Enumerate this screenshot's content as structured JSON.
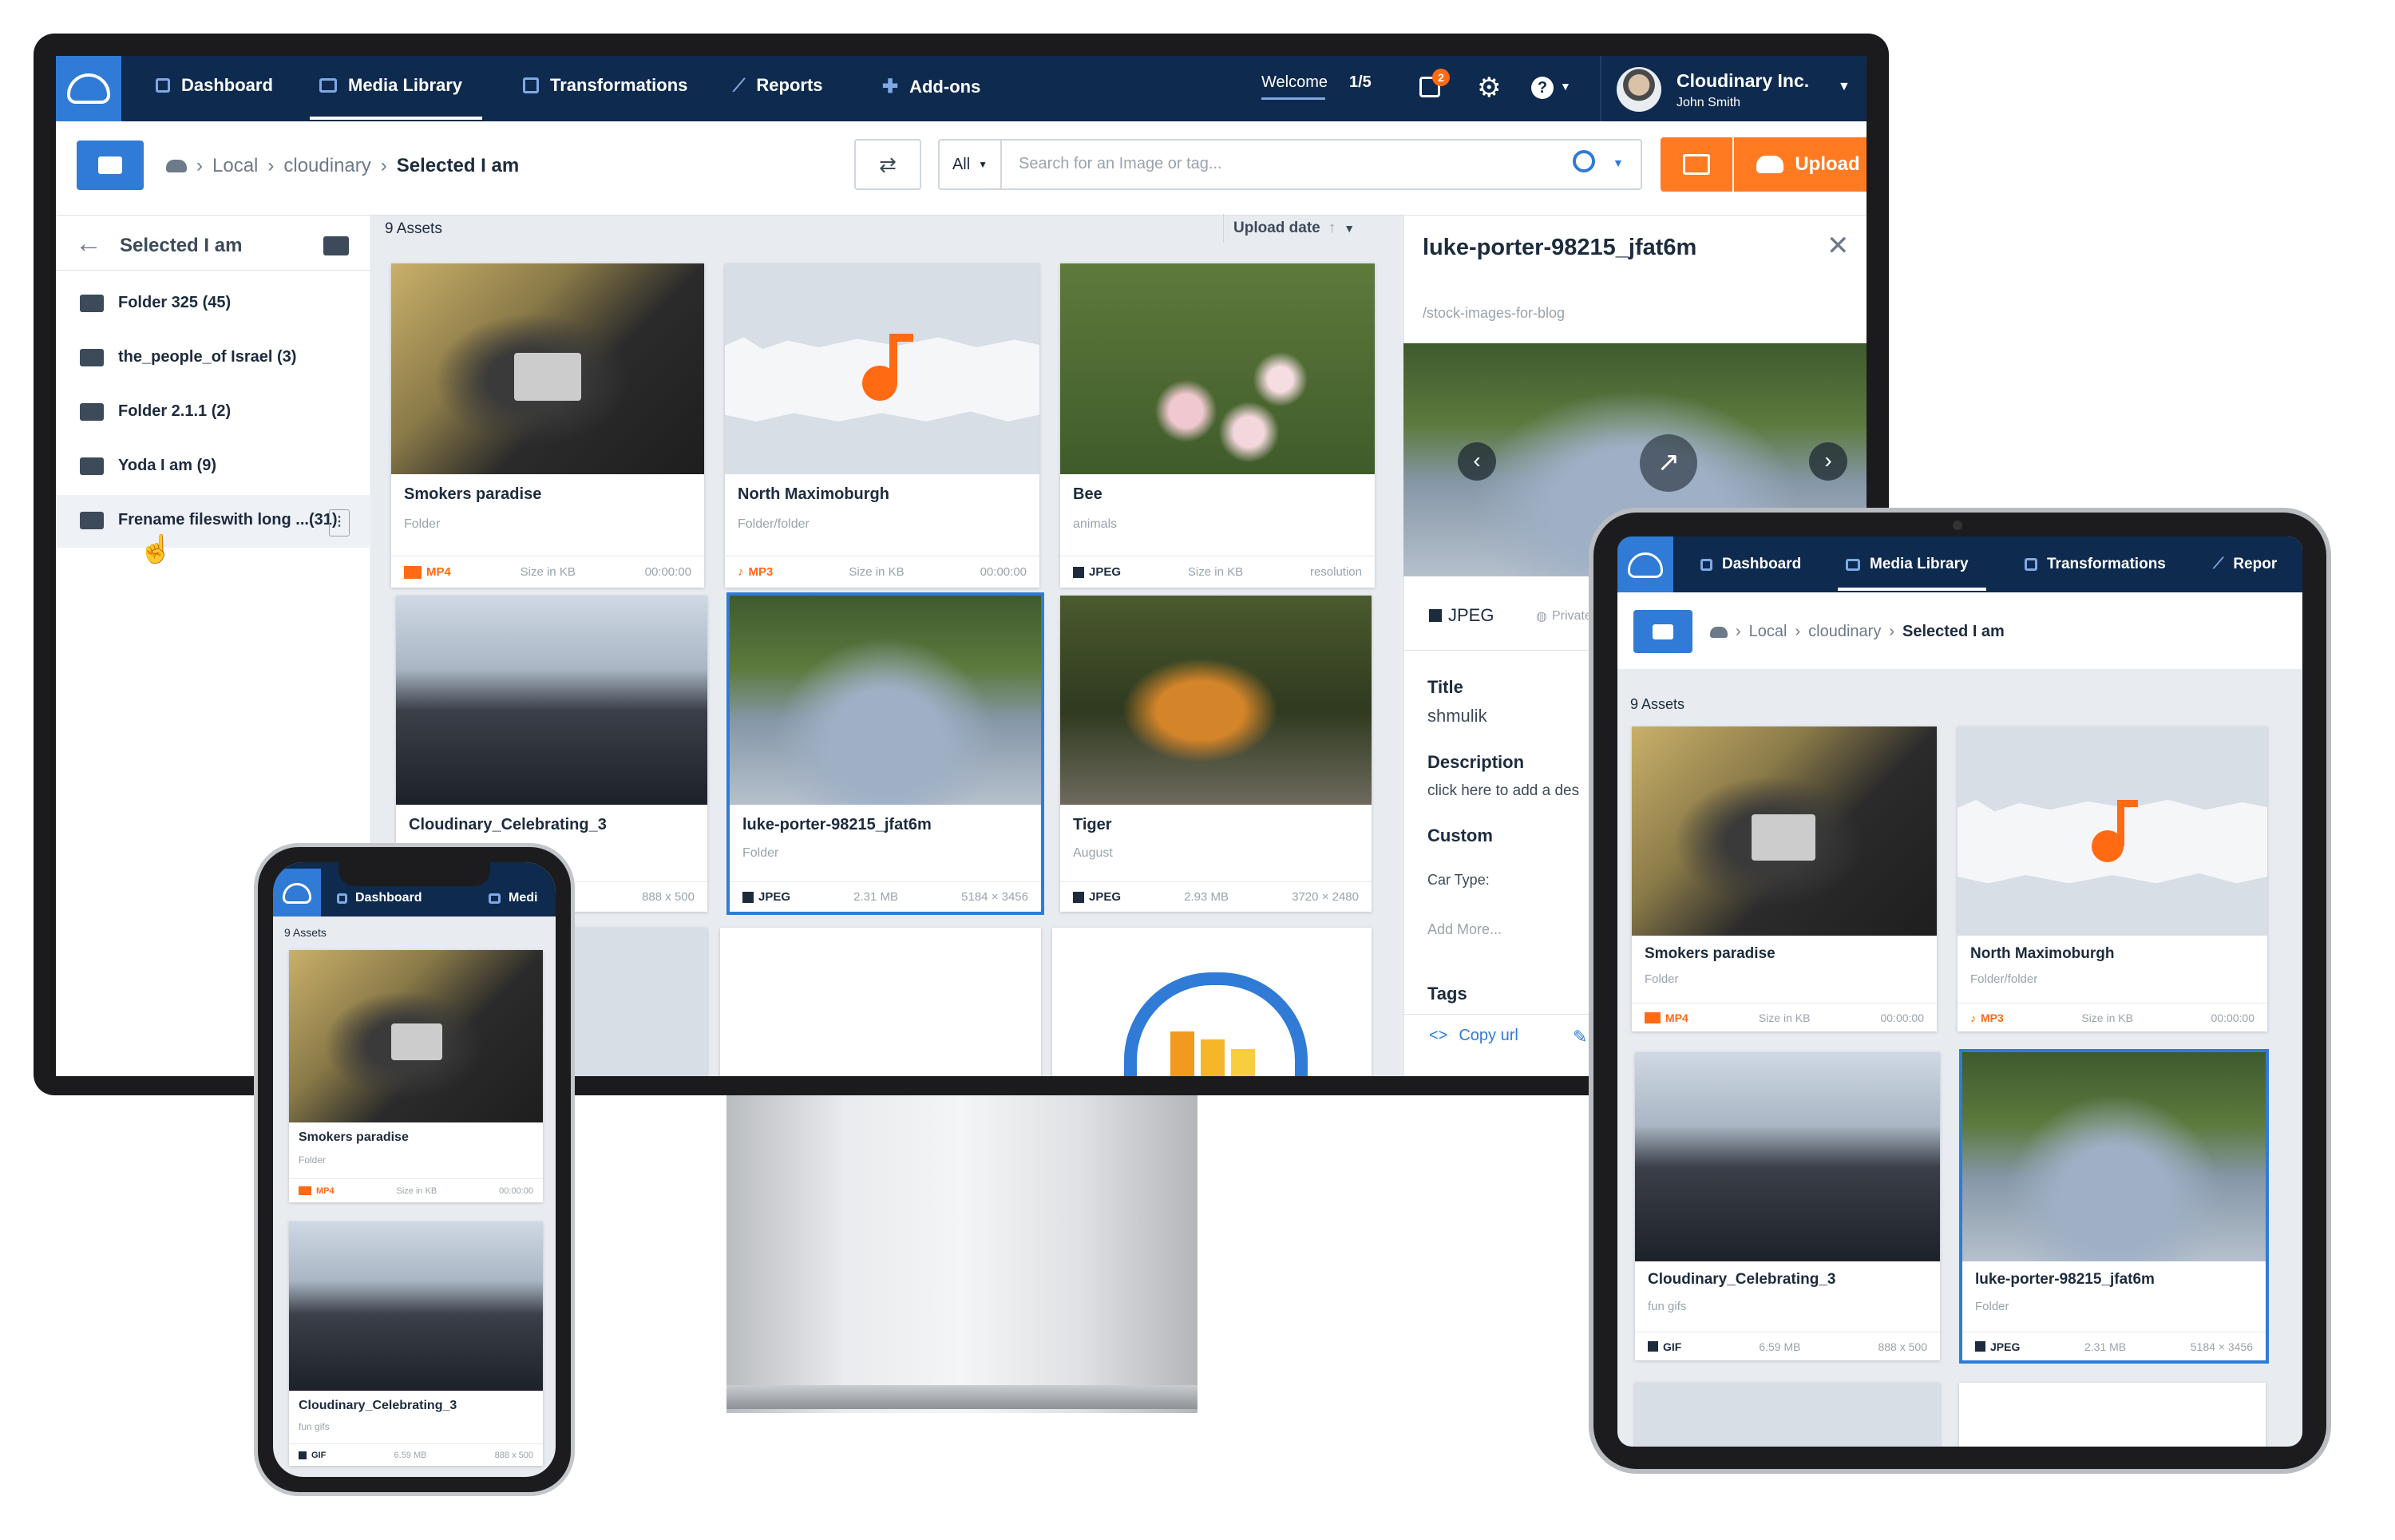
{
  "nav": {
    "items": [
      "Dashboard",
      "Media Library",
      "Transformations",
      "Reports",
      "Add-ons"
    ],
    "welcome": "Welcome",
    "welcome_count": "1/5",
    "badge": "2",
    "account": "Cloudinary Inc.",
    "user": "John Smith"
  },
  "breadcrumb": {
    "root": "Local",
    "folder": "cloudinary",
    "current": "Selected I am"
  },
  "search": {
    "filter": "All",
    "placeholder": "Search for an Image or tag..."
  },
  "upload_label": "Upload",
  "sidebar": {
    "title": "Selected I am",
    "folders": [
      {
        "name": "Folder 325",
        "count": "(45)"
      },
      {
        "name": "the_people_of Israel",
        "count": "(3)"
      },
      {
        "name": "Folder 2.1.1",
        "count": "(2)"
      },
      {
        "name": "Yoda I am",
        "count": "(9)"
      },
      {
        "name": "Frename fileswith long ...",
        "count": "(31)"
      }
    ]
  },
  "assets": {
    "count_label": "9 Assets",
    "sort_label": "Upload date",
    "items": [
      {
        "title": "Smokers paradise",
        "sub": "Folder",
        "format": "MP4",
        "size": "Size in KB",
        "meta": "00:00:00"
      },
      {
        "title": "North Maximoburgh",
        "sub": "Folder/folder",
        "format": "MP3",
        "size": "Size in KB",
        "meta": "00:00:00"
      },
      {
        "title": "Bee",
        "sub": "animals",
        "format": "JPEG",
        "size": "Size in KB",
        "meta": "resolution"
      },
      {
        "title": "Cloudinary_Celebrating_3",
        "sub": "fun gifs",
        "format": "GIF",
        "size": "6.59 MB",
        "meta": "888 x 500"
      },
      {
        "title": "luke-porter-98215_jfat6m",
        "sub": "Folder",
        "format": "JPEG",
        "size": "2.31 MB",
        "meta": "5184 × 3456"
      },
      {
        "title": "Tiger",
        "sub": "August",
        "format": "JPEG",
        "size": "2.93 MB",
        "meta": "3720 × 2480"
      }
    ]
  },
  "details": {
    "title": "luke-porter-98215_jfat6m",
    "path": "/stock-images-for-blog",
    "format": "JPEG",
    "privacy": "Private",
    "title_label": "Title",
    "title_value": "shmulik",
    "desc_label": "Description",
    "desc_value": "click here to add a des",
    "custom_label": "Custom",
    "car_type": "Car Type:",
    "add_more": "Add More...",
    "tags_label": "Tags",
    "copy_url": "Copy url"
  },
  "tablet": {
    "nav_items": [
      "Dashboard",
      "Media Library",
      "Transformations",
      "Repor"
    ]
  },
  "phone": {
    "nav_items": [
      "Dashboard",
      "Medi"
    ]
  },
  "colors": {
    "navy": "#0e2a4e",
    "blue": "#2f7bd6",
    "orange": "#ff6a13"
  }
}
